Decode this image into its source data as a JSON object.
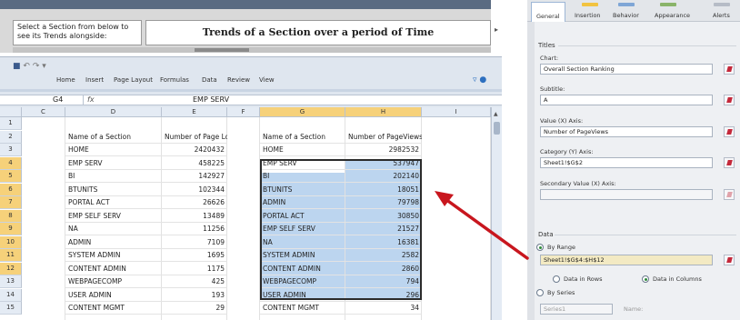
{
  "dashboard": {
    "section_prompt": "Select a Section from below to see its Trends alongside:",
    "trend_title": "Trends of a Section over a period of Time"
  },
  "excel": {
    "ribbon_tabs": [
      "Home",
      "Insert",
      "Page Layout",
      "Formulas",
      "Data",
      "Review",
      "View"
    ],
    "name_box": "G4",
    "fx_label": "fx",
    "formula_value": "EMP SERV",
    "columns": [
      "C",
      "D",
      "E",
      "F",
      "G",
      "H",
      "I"
    ],
    "rows": [
      "1",
      "2",
      "3",
      "4",
      "5",
      "6",
      "7",
      "8",
      "9",
      "10",
      "11",
      "12",
      "13",
      "14",
      "15"
    ],
    "selected_rows": [
      "4",
      "5",
      "6",
      "7",
      "8",
      "9",
      "10",
      "11",
      "12"
    ],
    "selected_columns": [
      "G",
      "H"
    ],
    "header_row": {
      "d": "Name of a Section",
      "e": "Number of Page Login",
      "g": "Name of a Section",
      "h": "Number of PageViews"
    },
    "data_rows": [
      {
        "row": "3",
        "d": "HOME",
        "e": "2420432",
        "g": "HOME",
        "h": "2982532"
      },
      {
        "row": "4",
        "d": "EMP SERV",
        "e": "458225",
        "g": "EMP SERV",
        "h": "537947"
      },
      {
        "row": "5",
        "d": "BI",
        "e": "142927",
        "g": "BI",
        "h": "202140"
      },
      {
        "row": "6",
        "d": "BTUNITS",
        "e": "102344",
        "g": "BTUNITS",
        "h": "18051"
      },
      {
        "row": "7",
        "d": "PORTAL ACT",
        "e": "26626",
        "g": "ADMIN",
        "h": "79798"
      },
      {
        "row": "8",
        "d": "EMP SELF SERV",
        "e": "13489",
        "g": "PORTAL ACT",
        "h": "30850"
      },
      {
        "row": "9",
        "d": "NA",
        "e": "11256",
        "g": "EMP SELF SERV",
        "h": "21527"
      },
      {
        "row": "10",
        "d": "ADMIN",
        "e": "7109",
        "g": "NA",
        "h": "16381"
      },
      {
        "row": "11",
        "d": "SYSTEM ADMIN",
        "e": "1695",
        "g": "SYSTEM ADMIN",
        "h": "2582"
      },
      {
        "row": "12",
        "d": "CONTENT ADMIN",
        "e": "1175",
        "g": "CONTENT ADMIN",
        "h": "2860"
      },
      {
        "row": "13",
        "d": "WEBPAGECOMP",
        "e": "425",
        "g": "WEBPAGECOMP",
        "h": "794"
      },
      {
        "row": "14",
        "d": "USER ADMIN",
        "e": "193",
        "g": "USER ADMIN",
        "h": "296"
      },
      {
        "row": "15",
        "d": "CONTENT MGMT",
        "e": "29",
        "g": "CONTENT MGMT",
        "h": "34"
      }
    ]
  },
  "panel": {
    "tabs": [
      "General",
      "Insertion",
      "Behavior",
      "Appearance",
      "Alerts"
    ],
    "active_tab": "General",
    "titles_group": "Titles",
    "chart_label": "Chart:",
    "chart_value": "Overall Section Ranking",
    "subtitle_label": "Subtitle:",
    "subtitle_value": "A",
    "value_axis_label": "Value (X) Axis:",
    "value_axis_value": "Number of PageViews",
    "category_axis_label": "Category (Y) Axis:",
    "category_axis_value": "Sheet1!$G$2",
    "secondary_axis_label": "Secondary Value (X) Axis:",
    "secondary_axis_value": "",
    "data_group": "Data",
    "by_range_label": "By Range",
    "range_value": "Sheet1!$G$4:$H$12",
    "data_in_rows": "Data in Rows",
    "data_in_columns": "Data in Columns",
    "by_series_label": "By Series",
    "series_box": "Series1",
    "name_label": "Name:"
  },
  "colors": {
    "selection_fill": "#bcd5ef",
    "selected_header": "#f6d17a",
    "arrow": "#c8161e",
    "active_radio": "#2e8b3a"
  }
}
